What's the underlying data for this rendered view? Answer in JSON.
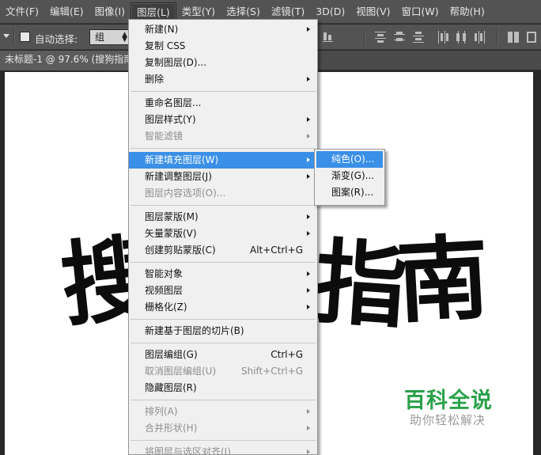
{
  "menubar": {
    "items": [
      {
        "label": "文件(F)"
      },
      {
        "label": "编辑(E)"
      },
      {
        "label": "图像(I)"
      },
      {
        "label": "图层(L)"
      },
      {
        "label": "类型(Y)"
      },
      {
        "label": "选择(S)"
      },
      {
        "label": "滤镜(T)"
      },
      {
        "label": "3D(D)"
      },
      {
        "label": "视图(V)"
      },
      {
        "label": "窗口(W)"
      },
      {
        "label": "帮助(H)"
      }
    ],
    "active_index": 3
  },
  "options_bar": {
    "auto_select_label": "自动选择:",
    "auto_select_checked": false,
    "auto_select_target": "组"
  },
  "document": {
    "tab_title": "未标题-1 @ 97.6% (搜狗指南"
  },
  "canvas": {
    "visible_chars": [
      "搜",
      "指",
      "南"
    ],
    "watermark_title": "百科全说",
    "watermark_subtitle": "助你轻松解决"
  },
  "layer_menu": {
    "items": [
      {
        "label": "新建(N)",
        "submenu": true
      },
      {
        "label": "复制 CSS"
      },
      {
        "label": "复制图层(D)..."
      },
      {
        "label": "删除",
        "submenu": true
      },
      {
        "separator": true
      },
      {
        "label": "重命名图层..."
      },
      {
        "label": "图层样式(Y)",
        "submenu": true
      },
      {
        "label": "智能滤镜",
        "submenu": true,
        "disabled": true
      },
      {
        "separator": true
      },
      {
        "label": "新建填充图层(W)",
        "submenu": true,
        "highlighted": true
      },
      {
        "label": "新建调整图层(J)",
        "submenu": true
      },
      {
        "label": "图层内容选项(O)...",
        "disabled": true
      },
      {
        "separator": true
      },
      {
        "label": "图层蒙版(M)",
        "submenu": true
      },
      {
        "label": "矢量蒙版(V)",
        "submenu": true
      },
      {
        "label": "创建剪贴蒙版(C)",
        "shortcut": "Alt+Ctrl+G"
      },
      {
        "separator": true
      },
      {
        "label": "智能对象",
        "submenu": true
      },
      {
        "label": "视频图层",
        "submenu": true
      },
      {
        "label": "栅格化(Z)",
        "submenu": true
      },
      {
        "separator": true
      },
      {
        "label": "新建基于图层的切片(B)"
      },
      {
        "separator": true
      },
      {
        "label": "图层编组(G)",
        "shortcut": "Ctrl+G"
      },
      {
        "label": "取消图层编组(U)",
        "shortcut": "Shift+Ctrl+G",
        "disabled": true
      },
      {
        "label": "隐藏图层(R)"
      },
      {
        "separator": true
      },
      {
        "label": "排列(A)",
        "submenu": true,
        "disabled": true
      },
      {
        "label": "合并形状(H)",
        "submenu": true,
        "disabled": true
      },
      {
        "separator": true
      },
      {
        "label": "将图层与选区对齐(I)",
        "submenu": true,
        "disabled": true
      }
    ]
  },
  "fill_layer_submenu": {
    "items": [
      {
        "label": "纯色(O)...",
        "highlighted": true
      },
      {
        "label": "渐变(G)..."
      },
      {
        "label": "图案(R)..."
      }
    ]
  },
  "colors": {
    "ui_dark": "#535353",
    "menu_bg": "#f0f0f0",
    "highlight": "#3a8fe6",
    "watermark_green": "#2aa14a"
  }
}
